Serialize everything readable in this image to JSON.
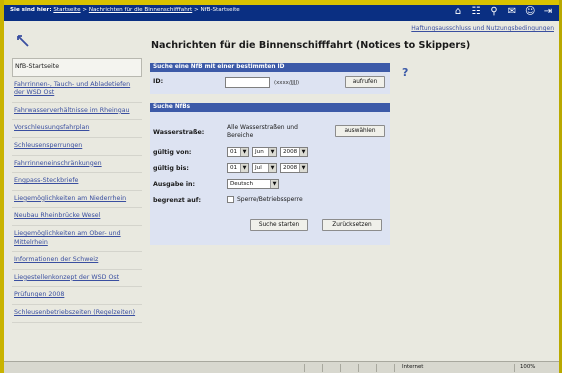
{
  "topbar": {
    "prefix": "Sie sind hier:",
    "crumb1": "Startseite",
    "sep1": ">",
    "crumb2": "Nachrichten für die Binnenschifffahrt",
    "sep2": ">",
    "crumb3": "NfB-Startseite"
  },
  "utility_link": "Haftungsausschluss und Nutzungsbedingungen",
  "sidebar": {
    "items": [
      {
        "label": "NfB-Startseite",
        "active": true
      },
      {
        "label": "Fahrrinnen-, Tauch- und Abladetiefen der WSD Ost"
      },
      {
        "label": "Fahrwasserverhältnisse im Rheingau"
      },
      {
        "label": "Vorschleusungsfahrplan"
      },
      {
        "label": "Schleusensperrungen"
      },
      {
        "label": "Fahrrinneneinschränkungen"
      },
      {
        "label": "Engpass-Steckbriefe"
      },
      {
        "label": "Liegemöglichkeiten am Niederrhein"
      },
      {
        "label": "Neubau Rheinbrücke Wesel"
      },
      {
        "label": "Liegemöglichkeiten am Ober- und Mittelrhein"
      },
      {
        "label": "Informationen der Schweiz"
      },
      {
        "label": "Liegestellenkonzept der WSD Ost"
      },
      {
        "label": "Prüfungen 2008"
      },
      {
        "label": "Schleusenbetriebszeiten (Regelzeiten)"
      }
    ]
  },
  "page_title": "Nachrichten für die Binnenschifffahrt (Notices to Skippers)",
  "search_id": {
    "header": "Suche eine NfB mit einer bestimmten ID",
    "id_label": "ID:",
    "id_value": "",
    "format_hint": "(xxxx/JJJJ)",
    "button": "aufrufen"
  },
  "search": {
    "header": "Suche NfBs",
    "waterway_label": "Wasserstraße:",
    "waterway_value": "Alle Wasserstraßen und Bereiche",
    "select_button": "auswählen",
    "valid_from_label": "gültig von:",
    "valid_from": {
      "day": "01",
      "month": "Jun",
      "year": "2008"
    },
    "valid_to_label": "gültig bis:",
    "valid_to": {
      "day": "01",
      "month": "Jul",
      "year": "2008"
    },
    "output_label": "Ausgabe in:",
    "output_value": "Deutsch",
    "limited_label": "begrenzt auf:",
    "closure_checkbox": "Sperre/Betriebssperre",
    "submit": "Suche starten",
    "reset": "Zurücksetzen"
  },
  "help_symbol": "?",
  "statusbar": {
    "zone": "Internet",
    "zoom": "100%"
  }
}
